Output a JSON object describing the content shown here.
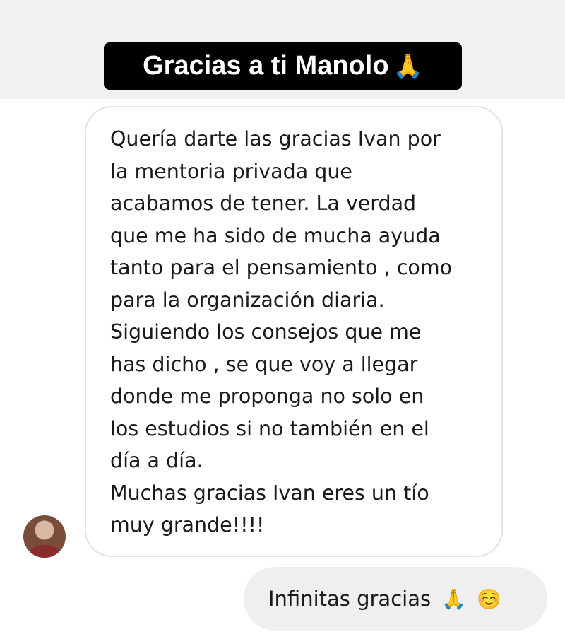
{
  "story_caption": {
    "text": "Gracias a ti  Manolo",
    "emoji": "🙏"
  },
  "received_message": {
    "text": "Quería darte las gracias Ivan por\nla mentoria privada que\nacabamos de tener. La verdad\nque me ha sido de mucha ayuda\ntanto para el pensamiento , como\npara la organización diaria.\nSiguiendo los consejos que me\nhas dicho , se que voy a llegar\ndonde me proponga no solo en\nlos estudios si no también en el\ndía a día.\nMuchas gracias Ivan eres un tío\nmuy grande!!!!"
  },
  "sent_message": {
    "text": "Infinitas gracias",
    "emoji_1": "🙏",
    "emoji_2": "☺️"
  },
  "sender": {
    "avatar_icon": "profile-photo"
  }
}
